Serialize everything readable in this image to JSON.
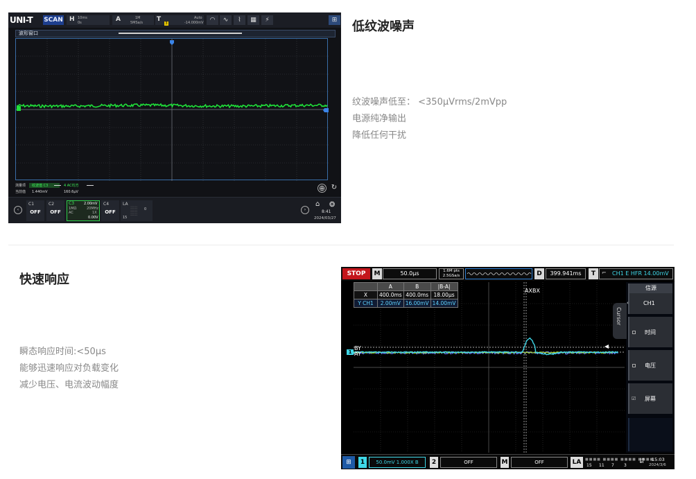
{
  "section1": {
    "title": "低纹波噪声",
    "features": [
      "纹波噪声低至： <350μVrms/2mVpp",
      "电源纯净输出",
      "降低任何干扰"
    ]
  },
  "section2": {
    "title": "快速响应",
    "features": [
      "瞬态响应时间:<50μs",
      "能够迅速响应对负载变化",
      "减少电压、电流波动幅度"
    ]
  },
  "scope1": {
    "logo": "UNI-T",
    "mode": "SCAN",
    "h_label": "H",
    "h_value": "10ms",
    "h_sub": "0s",
    "a_label": "A",
    "a_value": "1M",
    "a_sub": "5MSa/s",
    "t_label": "T",
    "t_mode": "Auto",
    "t_value": "-14.000mV",
    "t_badge": "3",
    "window_title": "波形窗口",
    "measure_label1": "测量项",
    "measure_label2": "当前值",
    "measure_item": "纹波值 C3",
    "measure_value1": "1.440mV",
    "measure_item2": "4 AC均方",
    "measure_value2": "160.6μV",
    "ch1": {
      "name": "C1",
      "state": "OFF"
    },
    "ch2": {
      "name": "C2",
      "state": "OFF"
    },
    "ch3": {
      "name": "C3",
      "scale": "2.00mV",
      "imp": "1MΩ",
      "bw": "20MHz",
      "probe": "1X",
      "coupling": "AC",
      "offset": "0.00V"
    },
    "ch4": {
      "name": "C4",
      "state": "OFF"
    },
    "la": {
      "name": "LA",
      "v1": "0",
      "v2": "15"
    },
    "time": "8:41",
    "date": "2024/03/27",
    "colors": {
      "trace": "#1fe23a",
      "accent": "#3a84e8"
    }
  },
  "scope2": {
    "stop": "STOP",
    "m_label": "M",
    "timebase": "50.0μs",
    "sample_rate1": "1.6M pts",
    "sample_rate2": "2.5GSa/s",
    "d_label": "D",
    "delay": "399.941ms",
    "t_label": "T",
    "trigger": "CH1 E HFR 14.00mV",
    "cursor_headers": [
      "",
      "A",
      "B",
      "|B-A|"
    ],
    "cursor_x": [
      "X",
      "400.0ms",
      "400.0ms",
      "18.00μs"
    ],
    "cursor_y": [
      "Y CH1",
      "2.00mV",
      "16.00mV",
      "14.00mV"
    ],
    "cursor_tab": "Cursor",
    "side": {
      "source_label": "信源",
      "source_value": "CH1",
      "time": "时间",
      "voltage": "电压",
      "screen": "屏幕"
    },
    "labels": {
      "axbx": "AXBX",
      "by": "BY",
      "ay": "AY"
    },
    "bottom": {
      "ch1_num": "1",
      "ch1_value": "50.0mV 1.000X B",
      "ch2_num": "2",
      "ch2_value": "OFF",
      "m_num": "M",
      "m_value": "OFF",
      "la": "LA",
      "la_values": [
        "15",
        "11",
        "7",
        "3"
      ],
      "time": "15:03",
      "date": "2024/3/6"
    },
    "colors": {
      "trace_ch1": "#3fd8e8",
      "trace_ch2": "#6a7cff",
      "trace_ch3": "#b3e81a",
      "stop": "#c4161c"
    }
  }
}
